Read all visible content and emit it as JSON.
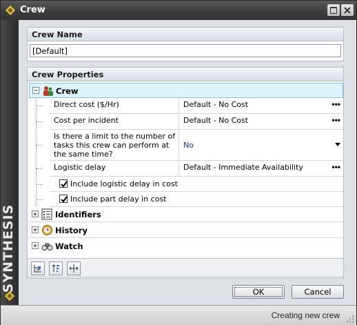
{
  "window": {
    "title": "Crew",
    "side_brand": "SYNTHESIS"
  },
  "crew_name": {
    "header": "Crew Name",
    "value": "[Default]"
  },
  "properties": {
    "header": "Crew Properties",
    "crew_category": "Crew",
    "rows": [
      {
        "label": "Direct cost ($/Hr)",
        "value": "Default - No Cost"
      },
      {
        "label": "Cost per incident",
        "value": "Default - No Cost"
      },
      {
        "label": "Is there a limit to the number of tasks this crew can perform at the same time?",
        "value": "No"
      },
      {
        "label": "Logistic delay",
        "value": "Default - Immediate Availability"
      }
    ],
    "checkboxes": [
      {
        "label": "Include logistic delay in cost",
        "checked": true
      },
      {
        "label": "Include part delay in cost",
        "checked": true
      }
    ],
    "categories": [
      "Identifiers",
      "History",
      "Watch"
    ]
  },
  "buttons": {
    "ok": "OK",
    "cancel": "Cancel"
  },
  "status": {
    "text": "Creating new crew"
  }
}
